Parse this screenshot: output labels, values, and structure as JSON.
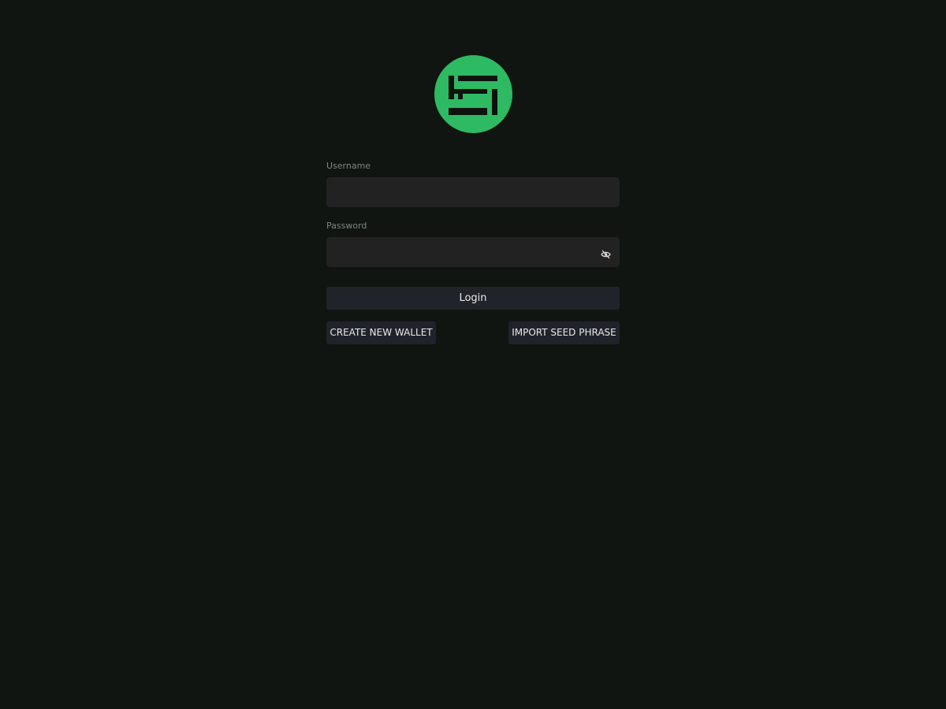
{
  "logo": {
    "icon": "wallet-logo-icon",
    "background_color": "#2dba62",
    "glyph_color": "#0d120f"
  },
  "username": {
    "label": "Username",
    "value": "",
    "placeholder": ""
  },
  "password": {
    "label": "Password",
    "value": "",
    "placeholder": "",
    "visibility_icon": "eye-slash-icon"
  },
  "actions": {
    "login_label": "Login",
    "create_wallet_label": "CREATE NEW WALLET",
    "import_seed_label": "IMPORT SEED PHRASE"
  },
  "colors": {
    "background": "#101511",
    "input_background": "#222223",
    "button_background": "#20242a"
  }
}
